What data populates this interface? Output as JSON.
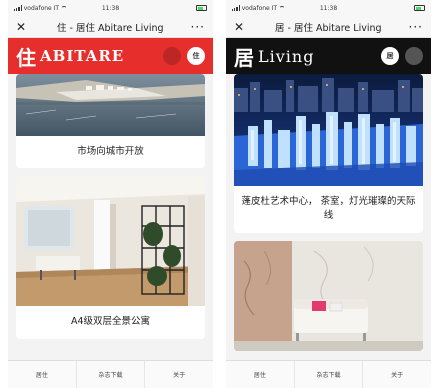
{
  "left": {
    "status": {
      "carrier": "vodafone IT",
      "time": "11:38"
    },
    "nav": {
      "close": "✕",
      "title": "住 - 居住 Abitare Living",
      "more": "···"
    },
    "brand": {
      "glyph": "住",
      "name": "ABITARE",
      "avatar": "住"
    },
    "cards": [
      {
        "title": "市场向城市开放"
      },
      {
        "title": "A4级双层全景公寓"
      }
    ],
    "tabs": [
      "居住",
      "杂志下载",
      "关于"
    ]
  },
  "right": {
    "status": {
      "carrier": "vodafone IT",
      "time": "11:38"
    },
    "nav": {
      "close": "✕",
      "title": "居 - 居住 Abitare Living",
      "more": "···"
    },
    "brand": {
      "glyph": "居",
      "name": "Living",
      "avatar": "居"
    },
    "cards": [
      {
        "title": "蓬皮杜艺术中心， 茶室，灯光璀璨的天际线"
      }
    ],
    "tabs": [
      "居住",
      "杂志下载",
      "关于"
    ]
  },
  "colors": {
    "abitare_red": "#e62f2d",
    "living_black": "#111111"
  }
}
